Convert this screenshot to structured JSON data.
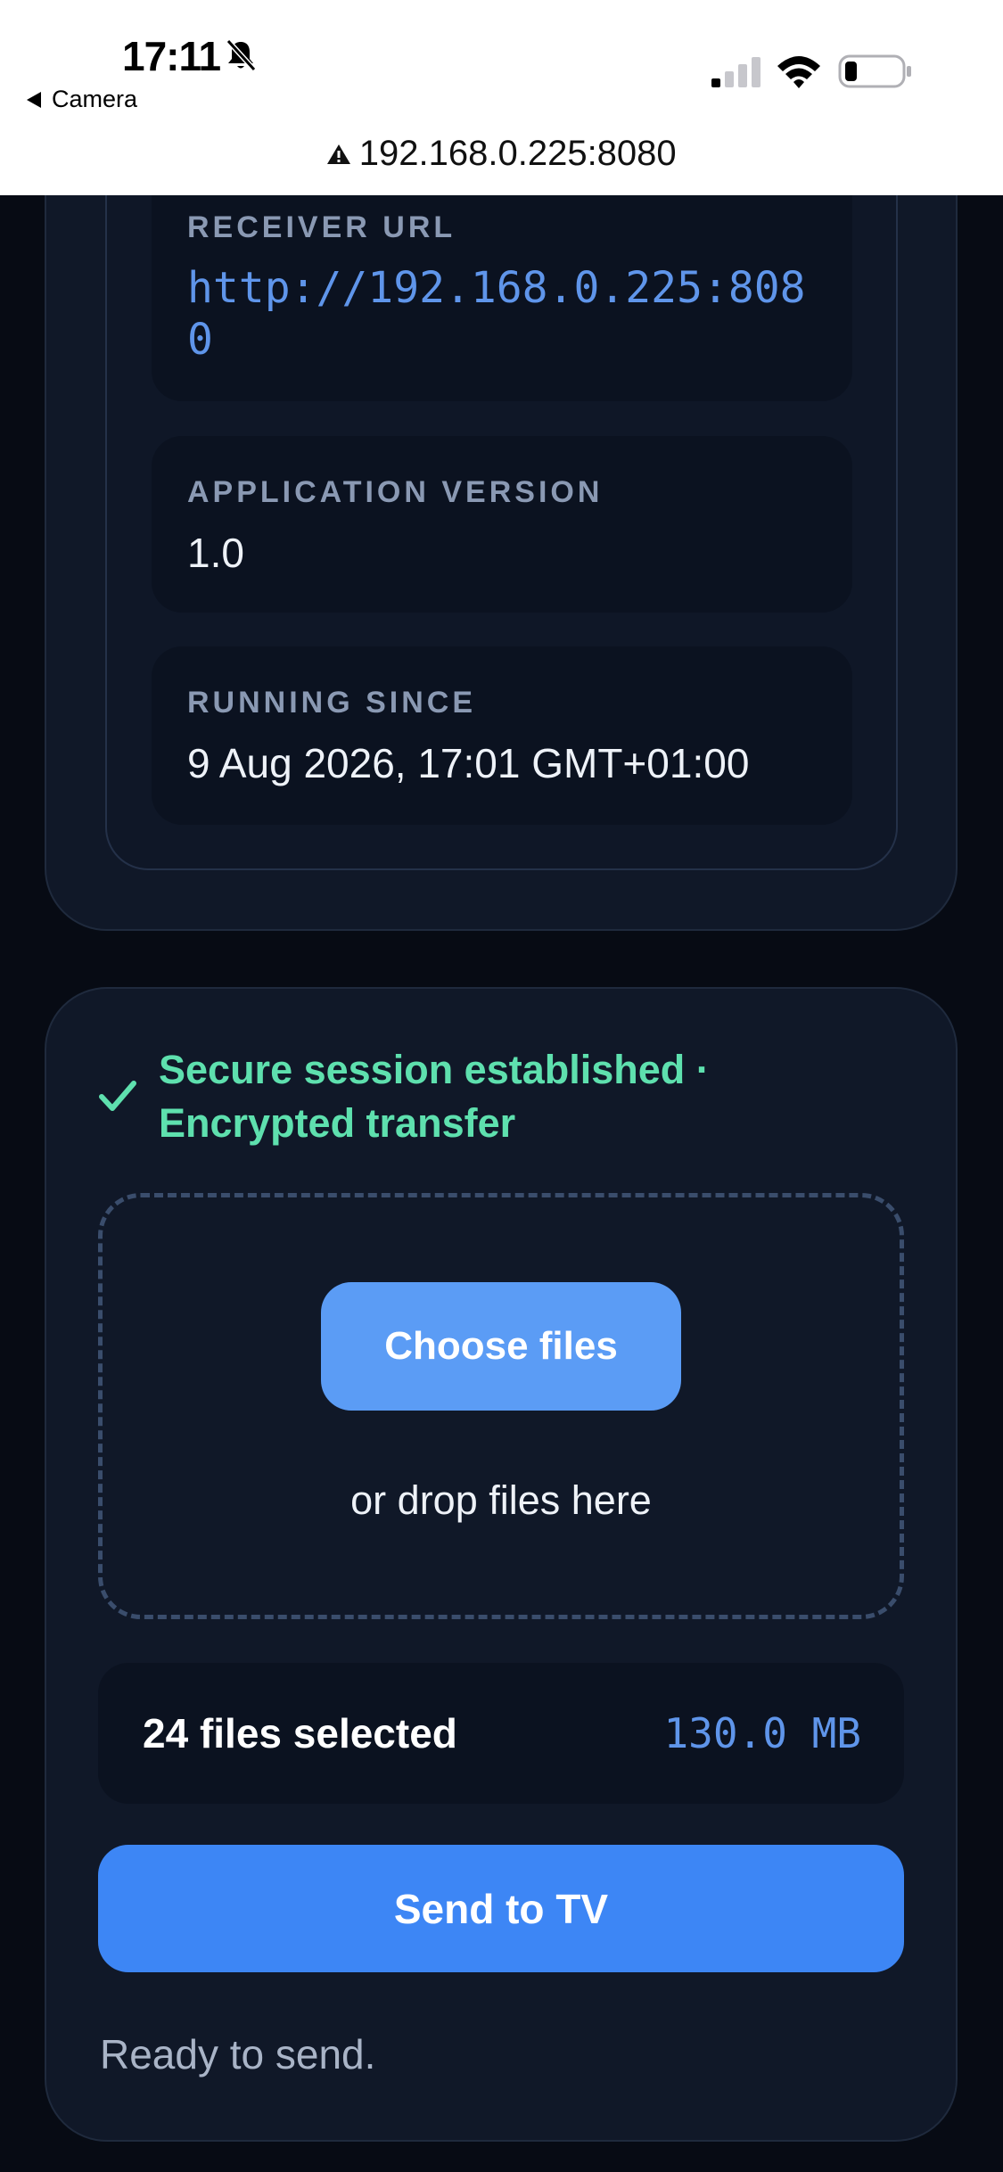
{
  "status_bar": {
    "time": "17:11",
    "back_app": "Camera",
    "icons": [
      "bell-slash-icon",
      "cellular-signal-icon",
      "wifi-icon",
      "battery-icon"
    ]
  },
  "browser": {
    "url": "192.168.0.225:8080",
    "security_icon": "warning-triangle-icon"
  },
  "info": {
    "receiver_url_label": "RECEIVER URL",
    "receiver_url": "http://192.168.0.225:8080",
    "version_label": "APPLICATION VERSION",
    "version": "1.0",
    "running_since_label": "RUNNING SINCE",
    "running_since": "9 Aug 2026, 17:01 GMT+01:00"
  },
  "transfer": {
    "session_line1": "Secure session established ·",
    "session_line2": "Encrypted transfer",
    "choose_files": "Choose files",
    "drop_hint": "or drop files here",
    "files_selected": "24 files selected",
    "total_size": "130.0 MB",
    "send_button": "Send to TV",
    "status": "Ready to send."
  },
  "colors": {
    "background": "#070b14",
    "card": "#101828",
    "accent_blue": "#3d86f5",
    "success_green": "#5ee0ae",
    "mono_blue": "#5f95ea"
  }
}
